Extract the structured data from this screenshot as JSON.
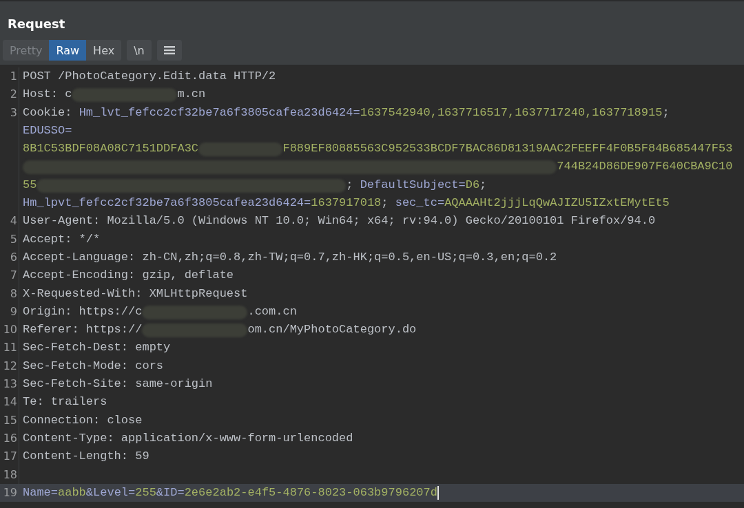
{
  "panel": {
    "title": "Request"
  },
  "view_tabs": [
    {
      "label": "Pretty",
      "selected": false,
      "disabled": true
    },
    {
      "label": "Raw",
      "selected": true,
      "disabled": false
    },
    {
      "label": "Hex",
      "selected": false,
      "disabled": false
    }
  ],
  "toolbar_buttons": [
    {
      "kind": "text",
      "label": "\\n"
    },
    {
      "kind": "menu"
    }
  ],
  "lines": [
    {
      "number": "1",
      "current": false,
      "rows": [
        [
          {
            "kind": "plain",
            "text": "POST /PhotoCategory.Edit.data HTTP/2"
          }
        ]
      ]
    },
    {
      "number": "2",
      "current": false,
      "rows": [
        [
          {
            "kind": "plain",
            "text": "Host: c"
          },
          {
            "kind": "redacted"
          },
          {
            "kind": "plain",
            "text": "m.cn"
          }
        ]
      ]
    },
    {
      "number": "3",
      "current": false,
      "rows": [
        [
          {
            "kind": "plain",
            "text": "Cookie: "
          },
          {
            "kind": "name",
            "text": "Hm_lvt_fefcc2cf32be7a6f3805cafea23d6424="
          },
          {
            "kind": "value",
            "text": "1637542940,1637716517,1637717240,1637718915"
          },
          {
            "kind": "plain",
            "text": ";"
          }
        ],
        [
          {
            "kind": "name",
            "text": "EDUSSO="
          }
        ],
        [
          {
            "kind": "value",
            "text": "8B1C53BDF08A08C7151DDFA3C"
          },
          {
            "kind": "redacted"
          },
          {
            "kind": "value",
            "text": "F889EF80885563C952533BCDF7BAC86D81319AAC2FEEFF4F0B5F84B685447F53"
          }
        ],
        [
          {
            "kind": "redacted"
          },
          {
            "kind": "value",
            "text": "744B24D86DE907F640CBA9C10"
          }
        ],
        [
          {
            "kind": "value",
            "text": "55"
          },
          {
            "kind": "redacted"
          },
          {
            "kind": "plain",
            "text": "; "
          },
          {
            "kind": "name",
            "text": "DefaultSubject="
          },
          {
            "kind": "value",
            "text": "D6"
          },
          {
            "kind": "plain",
            "text": ";"
          }
        ],
        [
          {
            "kind": "name",
            "text": "Hm_lpvt_fefcc2cf32be7a6f3805cafea23d6424="
          },
          {
            "kind": "value",
            "text": "1637917018"
          },
          {
            "kind": "plain",
            "text": "; "
          },
          {
            "kind": "name",
            "text": "sec_tc="
          },
          {
            "kind": "value",
            "text": "AQAAAHt2jjjLqQwAJIZU5IZxtEMytEt5"
          }
        ]
      ]
    },
    {
      "number": "4",
      "current": false,
      "rows": [
        [
          {
            "kind": "plain",
            "text": "User-Agent: Mozilla/5.0 (Windows NT 10.0; Win64; x64; rv:94.0) Gecko/20100101 Firefox/94.0"
          }
        ]
      ]
    },
    {
      "number": "5",
      "current": false,
      "rows": [
        [
          {
            "kind": "plain",
            "text": "Accept: */*"
          }
        ]
      ]
    },
    {
      "number": "6",
      "current": false,
      "rows": [
        [
          {
            "kind": "plain",
            "text": "Accept-Language: zh-CN,zh;q=0.8,zh-TW;q=0.7,zh-HK;q=0.5,en-US;q=0.3,en;q=0.2"
          }
        ]
      ]
    },
    {
      "number": "7",
      "current": false,
      "rows": [
        [
          {
            "kind": "plain",
            "text": "Accept-Encoding: gzip, deflate"
          }
        ]
      ]
    },
    {
      "number": "8",
      "current": false,
      "rows": [
        [
          {
            "kind": "plain",
            "text": "X-Requested-With: XMLHttpRequest"
          }
        ]
      ]
    },
    {
      "number": "9",
      "current": false,
      "rows": [
        [
          {
            "kind": "plain",
            "text": "Origin: https://c"
          },
          {
            "kind": "redacted"
          },
          {
            "kind": "plain",
            "text": ".com.cn"
          }
        ]
      ]
    },
    {
      "number": "10",
      "current": false,
      "rows": [
        [
          {
            "kind": "plain",
            "text": "Referer: https://"
          },
          {
            "kind": "redacted"
          },
          {
            "kind": "plain",
            "text": "om.cn/MyPhotoCategory.do"
          }
        ]
      ]
    },
    {
      "number": "11",
      "current": false,
      "rows": [
        [
          {
            "kind": "plain",
            "text": "Sec-Fetch-Dest: empty"
          }
        ]
      ]
    },
    {
      "number": "12",
      "current": false,
      "rows": [
        [
          {
            "kind": "plain",
            "text": "Sec-Fetch-Mode: cors"
          }
        ]
      ]
    },
    {
      "number": "13",
      "current": false,
      "rows": [
        [
          {
            "kind": "plain",
            "text": "Sec-Fetch-Site: same-origin"
          }
        ]
      ]
    },
    {
      "number": "14",
      "current": false,
      "rows": [
        [
          {
            "kind": "plain",
            "text": "Te: trailers"
          }
        ]
      ]
    },
    {
      "number": "15",
      "current": false,
      "rows": [
        [
          {
            "kind": "plain",
            "text": "Connection: close"
          }
        ]
      ]
    },
    {
      "number": "16",
      "current": false,
      "rows": [
        [
          {
            "kind": "plain",
            "text": "Content-Type: application/x-www-form-urlencoded"
          }
        ]
      ]
    },
    {
      "number": "17",
      "current": false,
      "rows": [
        [
          {
            "kind": "plain",
            "text": "Content-Length: 59"
          }
        ]
      ]
    },
    {
      "number": "18",
      "current": false,
      "rows": [
        []
      ]
    },
    {
      "number": "19",
      "current": true,
      "rows": [
        [
          {
            "kind": "name",
            "text": "Name="
          },
          {
            "kind": "value",
            "text": "aabb"
          },
          {
            "kind": "name",
            "text": "&Level="
          },
          {
            "kind": "value",
            "text": "255"
          },
          {
            "kind": "name",
            "text": "&ID="
          },
          {
            "kind": "value",
            "text": "2e6e2ab2-e4f5-4876-8023-063b9796207d"
          }
        ]
      ]
    }
  ]
}
